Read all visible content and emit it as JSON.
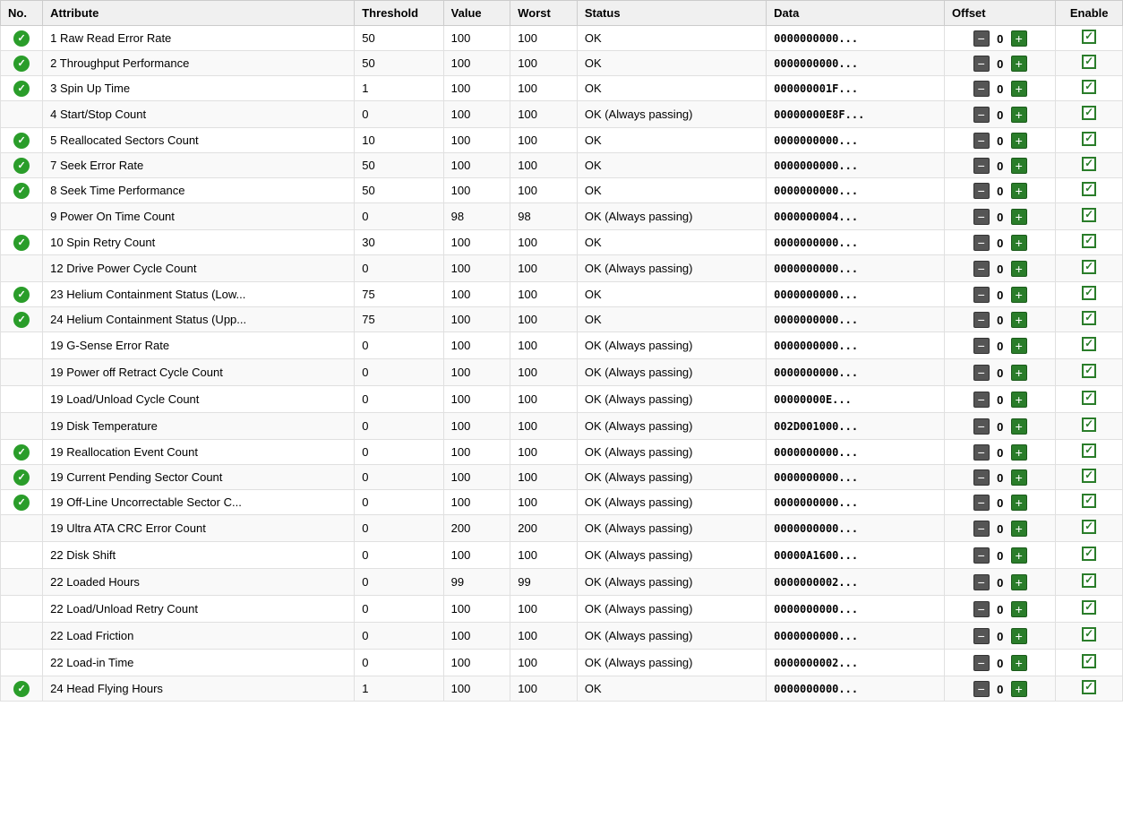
{
  "headers": {
    "no": "No.",
    "attribute": "Attribute",
    "threshold": "Threshold",
    "value": "Value",
    "worst": "Worst",
    "status": "Status",
    "data": "Data",
    "offset": "Offset",
    "enable": "Enable"
  },
  "rows": [
    {
      "no": "1",
      "hasCheck": true,
      "attribute": "Raw Read Error Rate",
      "threshold": "50",
      "value": "100",
      "worst": "100",
      "status": "OK",
      "data": "0000000000...",
      "offset": "0",
      "enable": true
    },
    {
      "no": "2",
      "hasCheck": true,
      "attribute": "Throughput Performance",
      "threshold": "50",
      "value": "100",
      "worst": "100",
      "status": "OK",
      "data": "0000000000...",
      "offset": "0",
      "enable": true
    },
    {
      "no": "3",
      "hasCheck": true,
      "attribute": "Spin Up Time",
      "threshold": "1",
      "value": "100",
      "worst": "100",
      "status": "OK",
      "data": "000000001F...",
      "offset": "0",
      "enable": true
    },
    {
      "no": "4",
      "hasCheck": false,
      "attribute": "Start/Stop Count",
      "threshold": "0",
      "value": "100",
      "worst": "100",
      "status": "OK (Always passing)",
      "data": "00000000E8F...",
      "offset": "0",
      "enable": true
    },
    {
      "no": "5",
      "hasCheck": true,
      "attribute": "Reallocated Sectors Count",
      "threshold": "10",
      "value": "100",
      "worst": "100",
      "status": "OK",
      "data": "0000000000...",
      "offset": "0",
      "enable": true
    },
    {
      "no": "7",
      "hasCheck": true,
      "attribute": "Seek Error Rate",
      "threshold": "50",
      "value": "100",
      "worst": "100",
      "status": "OK",
      "data": "0000000000...",
      "offset": "0",
      "enable": true
    },
    {
      "no": "8",
      "hasCheck": true,
      "attribute": "Seek Time Performance",
      "threshold": "50",
      "value": "100",
      "worst": "100",
      "status": "OK",
      "data": "0000000000...",
      "offset": "0",
      "enable": true
    },
    {
      "no": "9",
      "hasCheck": false,
      "attribute": "Power On Time Count",
      "threshold": "0",
      "value": "98",
      "worst": "98",
      "status": "OK (Always passing)",
      "data": "0000000004...",
      "offset": "0",
      "enable": true
    },
    {
      "no": "10",
      "hasCheck": true,
      "attribute": "Spin Retry Count",
      "threshold": "30",
      "value": "100",
      "worst": "100",
      "status": "OK",
      "data": "0000000000...",
      "offset": "0",
      "enable": true
    },
    {
      "no": "12",
      "hasCheck": false,
      "attribute": "Drive Power Cycle Count",
      "threshold": "0",
      "value": "100",
      "worst": "100",
      "status": "OK (Always passing)",
      "data": "0000000000...",
      "offset": "0",
      "enable": true
    },
    {
      "no": "23",
      "hasCheck": true,
      "attribute": "Helium Containment Status (Low...",
      "threshold": "75",
      "value": "100",
      "worst": "100",
      "status": "OK",
      "data": "0000000000...",
      "offset": "0",
      "enable": true
    },
    {
      "no": "24",
      "hasCheck": true,
      "attribute": "Helium Containment Status (Upp...",
      "threshold": "75",
      "value": "100",
      "worst": "100",
      "status": "OK",
      "data": "0000000000...",
      "offset": "0",
      "enable": true
    },
    {
      "no": "19",
      "hasCheck": false,
      "attribute": "G-Sense Error Rate",
      "threshold": "0",
      "value": "100",
      "worst": "100",
      "status": "OK (Always passing)",
      "data": "0000000000...",
      "offset": "0",
      "enable": true
    },
    {
      "no": "19",
      "hasCheck": false,
      "attribute": "Power off Retract Cycle Count",
      "threshold": "0",
      "value": "100",
      "worst": "100",
      "status": "OK (Always passing)",
      "data": "0000000000...",
      "offset": "0",
      "enable": true
    },
    {
      "no": "19",
      "hasCheck": false,
      "attribute": "Load/Unload Cycle Count",
      "threshold": "0",
      "value": "100",
      "worst": "100",
      "status": "OK (Always passing)",
      "data": "00000000E...",
      "offset": "0",
      "enable": true
    },
    {
      "no": "19",
      "hasCheck": false,
      "attribute": "Disk Temperature",
      "threshold": "0",
      "value": "100",
      "worst": "100",
      "status": "OK (Always passing)",
      "data": "002D001000...",
      "offset": "0",
      "enable": true
    },
    {
      "no": "19",
      "hasCheck": true,
      "attribute": "Reallocation Event Count",
      "threshold": "0",
      "value": "100",
      "worst": "100",
      "status": "OK (Always passing)",
      "data": "0000000000...",
      "offset": "0",
      "enable": true
    },
    {
      "no": "19",
      "hasCheck": true,
      "attribute": "Current Pending Sector Count",
      "threshold": "0",
      "value": "100",
      "worst": "100",
      "status": "OK (Always passing)",
      "data": "0000000000...",
      "offset": "0",
      "enable": true
    },
    {
      "no": "19",
      "hasCheck": true,
      "attribute": "Off-Line Uncorrectable Sector C...",
      "threshold": "0",
      "value": "100",
      "worst": "100",
      "status": "OK (Always passing)",
      "data": "0000000000...",
      "offset": "0",
      "enable": true
    },
    {
      "no": "19",
      "hasCheck": false,
      "attribute": "Ultra ATA CRC Error Count",
      "threshold": "0",
      "value": "200",
      "worst": "200",
      "status": "OK (Always passing)",
      "data": "0000000000...",
      "offset": "0",
      "enable": true
    },
    {
      "no": "22",
      "hasCheck": false,
      "attribute": "Disk Shift",
      "threshold": "0",
      "value": "100",
      "worst": "100",
      "status": "OK (Always passing)",
      "data": "00000A1600...",
      "offset": "0",
      "enable": true
    },
    {
      "no": "22",
      "hasCheck": false,
      "attribute": "Loaded Hours",
      "threshold": "0",
      "value": "99",
      "worst": "99",
      "status": "OK (Always passing)",
      "data": "0000000002...",
      "offset": "0",
      "enable": true
    },
    {
      "no": "22",
      "hasCheck": false,
      "attribute": "Load/Unload Retry Count",
      "threshold": "0",
      "value": "100",
      "worst": "100",
      "status": "OK (Always passing)",
      "data": "0000000000...",
      "offset": "0",
      "enable": true
    },
    {
      "no": "22",
      "hasCheck": false,
      "attribute": "Load Friction",
      "threshold": "0",
      "value": "100",
      "worst": "100",
      "status": "OK (Always passing)",
      "data": "0000000000...",
      "offset": "0",
      "enable": true
    },
    {
      "no": "22",
      "hasCheck": false,
      "attribute": "Load-in Time",
      "threshold": "0",
      "value": "100",
      "worst": "100",
      "status": "OK (Always passing)",
      "data": "0000000002...",
      "offset": "0",
      "enable": true
    },
    {
      "no": "24",
      "hasCheck": true,
      "attribute": "Head Flying Hours",
      "threshold": "1",
      "value": "100",
      "worst": "100",
      "status": "OK",
      "data": "0000000000...",
      "offset": "0",
      "enable": true
    }
  ]
}
